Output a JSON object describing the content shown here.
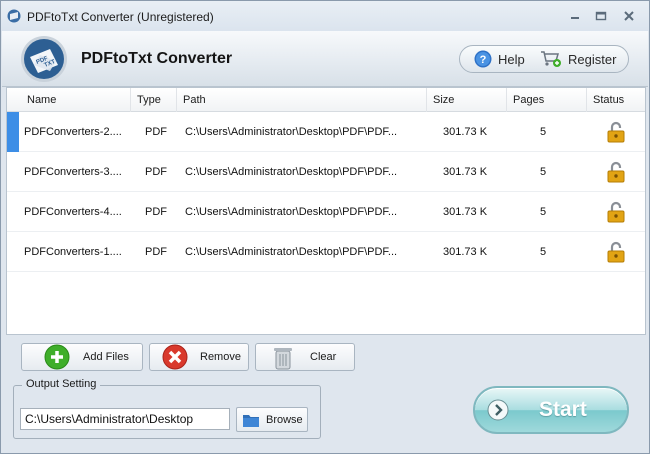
{
  "window": {
    "title": "PDFtoTxt Converter (Unregistered)",
    "icon": "pdf-to-txt-app-icon"
  },
  "header": {
    "app_name": "PDFtoTxt Converter",
    "logo_text_top": "PDF",
    "logo_text_bottom": "TXT",
    "help_label": "Help",
    "register_label": "Register"
  },
  "table": {
    "columns": [
      "Name",
      "Type",
      "Path",
      "Size",
      "Pages",
      "Status"
    ],
    "rows": [
      {
        "name": "PDFConverters-2....",
        "type": "PDF",
        "path": "C:\\Users\\Administrator\\Desktop\\PDF\\PDF...",
        "size": "301.73 K",
        "pages": "5",
        "status": "unlocked"
      },
      {
        "name": "PDFConverters-3....",
        "type": "PDF",
        "path": "C:\\Users\\Administrator\\Desktop\\PDF\\PDF...",
        "size": "301.73 K",
        "pages": "5",
        "status": "unlocked"
      },
      {
        "name": "PDFConverters-4....",
        "type": "PDF",
        "path": "C:\\Users\\Administrator\\Desktop\\PDF\\PDF...",
        "size": "301.73 K",
        "pages": "5",
        "status": "unlocked"
      },
      {
        "name": "PDFConverters-1....",
        "type": "PDF",
        "path": "C:\\Users\\Administrator\\Desktop\\PDF\\PDF...",
        "size": "301.73 K",
        "pages": "5",
        "status": "unlocked"
      }
    ]
  },
  "actions": {
    "add_label": "Add Files",
    "remove_label": "Remove",
    "clear_label": "Clear"
  },
  "output": {
    "legend": "Output Setting",
    "path_value": "C:\\Users\\Administrator\\Desktop",
    "browse_label": "Browse"
  },
  "start_label": "Start",
  "colors": {
    "accent": "#3d8ee6",
    "start": "#7bc9cd",
    "add": "#3fae2a",
    "remove": "#d9392c",
    "lock": "#e2a414"
  }
}
